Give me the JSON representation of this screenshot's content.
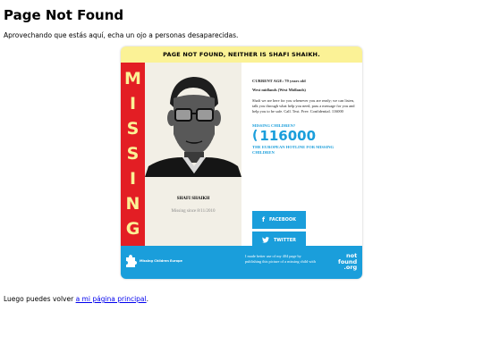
{
  "page": {
    "title": "Page Not Found",
    "intro": "Aprovechando que estás aquí, echa un ojo a personas desaparecidas.",
    "footer_prefix": "Luego puedes volver ",
    "footer_link": "a mi página principal",
    "footer_suffix": "."
  },
  "card": {
    "banner": "PAGE NOT FOUND, NEITHER IS SHAFI SHAIKH.",
    "missing_letters": [
      "M",
      "I",
      "S",
      "S",
      "I",
      "N",
      "G"
    ],
    "person_name": "SHAFI SHAIKH",
    "missing_since": "Missing since 8/11/2010",
    "current_age": "CURRENT AGE: 79 years old",
    "location": "West midlands (West Midlands)",
    "description": "Shafi we are here for you whenever you are ready; we can listen, talk you through what help you need, pass a message for you and help you to be safe. Call. Text. Free. Confidential. 116000",
    "missing_children_label": "MISSING CHILDREN?",
    "hotline_number": "116000",
    "hotline_description": "THE EUROPEAN HOTLINE FOR MISSING CHILDREN",
    "facebook_label": "FACEBOOK",
    "twitter_label": "TWITTER",
    "bottom_note": "I made better use of my 404 page by publishing this picture of a missing child with",
    "org_logo_text": "Missing Children Europe",
    "notfound_logo_lines": [
      "not",
      "found",
      ".org"
    ]
  },
  "colors": {
    "red": "#e31e24",
    "yellow": "#fbf296",
    "blue": "#1a9edb",
    "photo_bg": "#f2efe6"
  }
}
